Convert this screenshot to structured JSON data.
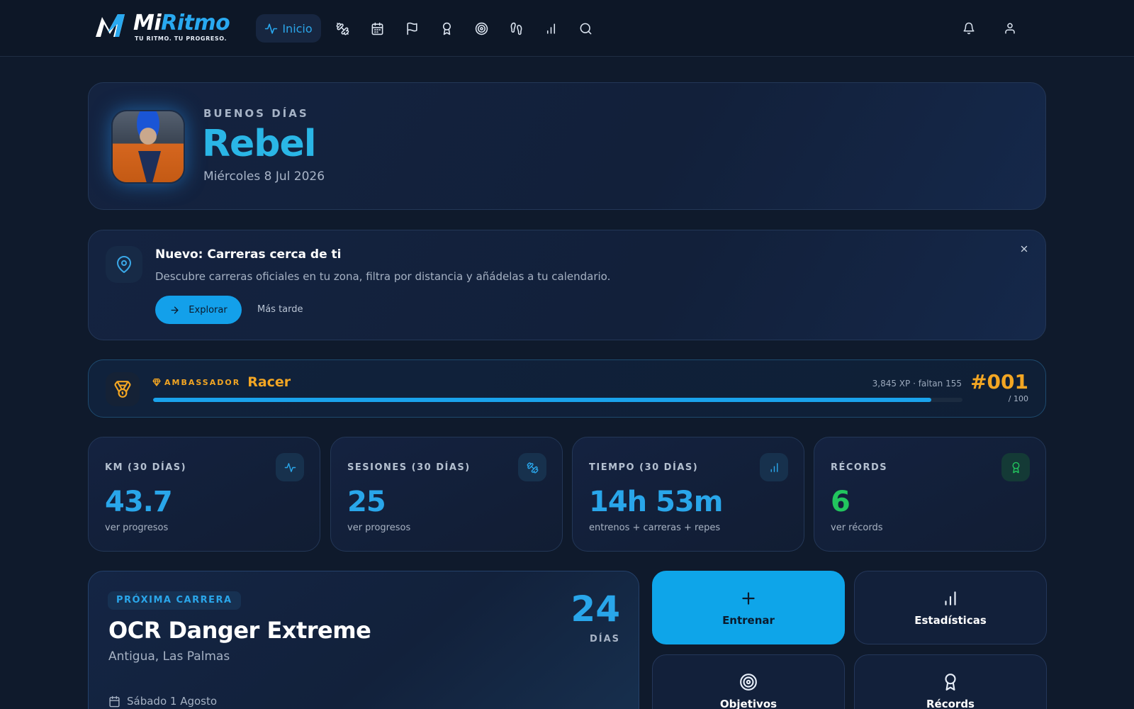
{
  "brand": {
    "name_part1": "Mi",
    "name_part2": "Ritmo",
    "tagline": "TU RITMO. TU PROGRESO."
  },
  "nav": {
    "items": [
      {
        "label": "Inicio",
        "icon": "activity-icon",
        "active": true
      },
      {
        "icon": "dumbbell-icon"
      },
      {
        "icon": "calendar-icon"
      },
      {
        "icon": "flag-icon"
      },
      {
        "icon": "award-icon"
      },
      {
        "icon": "target-icon"
      },
      {
        "icon": "footprints-icon"
      },
      {
        "icon": "bar-chart-icon"
      },
      {
        "icon": "search-icon"
      }
    ],
    "right_icons": [
      "bell-icon",
      "user-icon"
    ]
  },
  "greeting": {
    "kicker": "BUENOS DÍAS",
    "name": "Rebel",
    "date": "Miércoles 8 Jul 2026"
  },
  "banner": {
    "title": "Nuevo: Carreras cerca de ti",
    "description": "Descubre carreras oficiales en tu zona, filtra por distancia y añádelas a tu calendario.",
    "primary_label": "Explorar",
    "secondary_label": "Más tarde"
  },
  "xp": {
    "tier": "AMBASSADOR",
    "rank": "Racer",
    "meta": "3,845 XP · faltan 155",
    "progress": 0.9612,
    "number": "#001",
    "of": "/ 100"
  },
  "stats": [
    {
      "label": "KM (30 DÍAS)",
      "value": "43.7",
      "sub": "ver progresos",
      "icon": "activity-icon",
      "color": "#29a6ea"
    },
    {
      "label": "SESIONES (30 DÍAS)",
      "value": "25",
      "sub": "ver progresos",
      "icon": "dumbbell-icon",
      "color": "#29a6ea"
    },
    {
      "label": "TIEMPO (30 DÍAS)",
      "value": "14h 53m",
      "sub": "entrenos + carreras + repes",
      "icon": "bar-chart-icon",
      "color": "#29a6ea"
    },
    {
      "label": "RÉCORDS",
      "value": "6",
      "sub": "ver récords",
      "icon": "award-icon",
      "color": "#22c55e"
    }
  ],
  "race": {
    "tag": "PRÓXIMA CARRERA",
    "name": "OCR Danger Extreme",
    "place": "Antigua, Las Palmas",
    "days": "24",
    "days_label": "DÍAS",
    "date": "Sábado 1 Agosto"
  },
  "quick_actions": [
    {
      "label": "Entrenar",
      "icon": "plus-icon"
    },
    {
      "label": "Estadísticas",
      "icon": "bar-chart-icon"
    },
    {
      "label": "Objetivos",
      "icon": "target-icon"
    },
    {
      "label": "Récords",
      "icon": "award-icon"
    }
  ],
  "colors": {
    "accent": "#29a6ea",
    "gold": "#f3a623",
    "green": "#22c55e",
    "background": "#0f1a2c"
  }
}
